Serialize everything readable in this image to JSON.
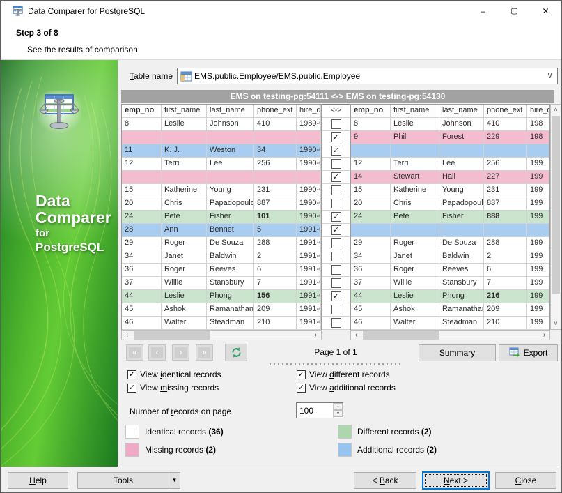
{
  "window": {
    "title": "Data Comparer for PostgreSQL"
  },
  "icons": {
    "minimize": "–",
    "maximize": "▢",
    "close": "✕",
    "chevron_down": "∨",
    "dropdown_arrow": "▼",
    "spin_up": "▲",
    "spin_down": "▼",
    "check": "✓",
    "scroll_left": "‹",
    "scroll_right": "›",
    "scroll_up": "˄",
    "scroll_down": "˅"
  },
  "wizard": {
    "step": "Step 3 of 8",
    "subtitle": "See the results of comparison"
  },
  "sidebar": {
    "brand1": "Data",
    "brand2": "Comparer",
    "brand3": "for",
    "brand4": "PostgreSQL"
  },
  "table_bar": {
    "label": {
      "pre": "",
      "key": "T",
      "post": "able name"
    },
    "value": "EMS.public.Employee/EMS.public.Employee"
  },
  "caption": "EMS on testing-pg:54111 <-> EMS on testing-pg:54130",
  "grid": {
    "columns": [
      "emp_no",
      "first_name",
      "last_name",
      "phone_ext",
      "hire_date"
    ],
    "compare_header": "<->",
    "left_rows": [
      {
        "cells": [
          "8",
          "Leslie",
          "Johnson",
          "410",
          "1989-0"
        ],
        "type": "identical"
      },
      {
        "cells": [
          "",
          "",
          "",
          "",
          ""
        ],
        "type": "missing"
      },
      {
        "cells": [
          "11",
          "K. J.",
          "Weston",
          "34",
          "1990-0"
        ],
        "type": "additional"
      },
      {
        "cells": [
          "12",
          "Terri",
          "Lee",
          "256",
          "1990-0"
        ],
        "type": "identical"
      },
      {
        "cells": [
          "",
          "",
          "",
          "",
          ""
        ],
        "type": "missing"
      },
      {
        "cells": [
          "15",
          "Katherine",
          "Young",
          "231",
          "1990-0"
        ],
        "type": "identical"
      },
      {
        "cells": [
          "20",
          "Chris",
          "Papadopoulos",
          "887",
          "1990-0"
        ],
        "type": "identical"
      },
      {
        "cells": [
          "24",
          "Pete",
          "Fisher",
          "101",
          "1990-0"
        ],
        "type": "different",
        "bold": 3
      },
      {
        "cells": [
          "28",
          "Ann",
          "Bennet",
          "5",
          "1991-0"
        ],
        "type": "additional"
      },
      {
        "cells": [
          "29",
          "Roger",
          "De Souza",
          "288",
          "1991-0"
        ],
        "type": "identical"
      },
      {
        "cells": [
          "34",
          "Janet",
          "Baldwin",
          "2",
          "1991-0"
        ],
        "type": "identical"
      },
      {
        "cells": [
          "36",
          "Roger",
          "Reeves",
          "6",
          "1991-0"
        ],
        "type": "identical"
      },
      {
        "cells": [
          "37",
          "Willie",
          "Stansbury",
          "7",
          "1991-0"
        ],
        "type": "identical"
      },
      {
        "cells": [
          "44",
          "Leslie",
          "Phong",
          "156",
          "1991-0"
        ],
        "type": "different",
        "bold": 3
      },
      {
        "cells": [
          "45",
          "Ashok",
          "Ramanathan",
          "209",
          "1991-0"
        ],
        "type": "identical"
      },
      {
        "cells": [
          "46",
          "Walter",
          "Steadman",
          "210",
          "1991-0"
        ],
        "type": "identical"
      }
    ],
    "selected": [
      false,
      true,
      true,
      false,
      true,
      false,
      false,
      true,
      true,
      false,
      false,
      false,
      false,
      true,
      false,
      false
    ],
    "right_rows": [
      {
        "cells": [
          "8",
          "Leslie",
          "Johnson",
          "410",
          "198"
        ],
        "type": "identical"
      },
      {
        "cells": [
          "9",
          "Phil",
          "Forest",
          "229",
          "198"
        ],
        "type": "missing"
      },
      {
        "cells": [
          "",
          "",
          "",
          "",
          ""
        ],
        "type": "additional"
      },
      {
        "cells": [
          "12",
          "Terri",
          "Lee",
          "256",
          "199"
        ],
        "type": "identical"
      },
      {
        "cells": [
          "14",
          "Stewart",
          "Hall",
          "227",
          "199"
        ],
        "type": "missing"
      },
      {
        "cells": [
          "15",
          "Katherine",
          "Young",
          "231",
          "199"
        ],
        "type": "identical"
      },
      {
        "cells": [
          "20",
          "Chris",
          "Papadopoulos",
          "887",
          "199"
        ],
        "type": "identical"
      },
      {
        "cells": [
          "24",
          "Pete",
          "Fisher",
          "888",
          "199"
        ],
        "type": "different",
        "bold": 3
      },
      {
        "cells": [
          "",
          "",
          "",
          "",
          ""
        ],
        "type": "additional"
      },
      {
        "cells": [
          "29",
          "Roger",
          "De Souza",
          "288",
          "199"
        ],
        "type": "identical"
      },
      {
        "cells": [
          "34",
          "Janet",
          "Baldwin",
          "2",
          "199"
        ],
        "type": "identical"
      },
      {
        "cells": [
          "36",
          "Roger",
          "Reeves",
          "6",
          "199"
        ],
        "type": "identical"
      },
      {
        "cells": [
          "37",
          "Willie",
          "Stansbury",
          "7",
          "199"
        ],
        "type": "identical"
      },
      {
        "cells": [
          "44",
          "Leslie",
          "Phong",
          "216",
          "199"
        ],
        "type": "different",
        "bold": 3
      },
      {
        "cells": [
          "45",
          "Ashok",
          "Ramanathan",
          "209",
          "199"
        ],
        "type": "identical"
      },
      {
        "cells": [
          "46",
          "Walter",
          "Steadman",
          "210",
          "199"
        ],
        "type": "identical"
      }
    ]
  },
  "pager": {
    "first": "«",
    "prev": "‹",
    "next": "›",
    "last": "»",
    "page": "Page 1 of 1"
  },
  "actions": {
    "summary": "Summary",
    "export": "Export"
  },
  "options": {
    "view_identical": {
      "pre": "View ",
      "key": "i",
      "post": "dentical records"
    },
    "view_different": {
      "pre": "View ",
      "key": "d",
      "post": "ifferent records"
    },
    "view_missing": {
      "pre": "View ",
      "key": "m",
      "post": "issing records"
    },
    "view_additional": {
      "pre": "View ",
      "key": "a",
      "post": "dditional records"
    },
    "records_label": {
      "pre": "Number of ",
      "key": "r",
      "post": "ecords on page"
    },
    "records_value": "100"
  },
  "legend": {
    "items": [
      {
        "label": "Identical records ",
        "count": "(36)",
        "color": "#FFFFFF"
      },
      {
        "label": "Different records ",
        "count": "(2)",
        "color": "#ABD6AE"
      },
      {
        "label": "Missing records ",
        "count": "(2)",
        "color": "#F0A9C6"
      },
      {
        "label": "Additional records ",
        "count": "(2)",
        "color": "#97C4EE"
      }
    ]
  },
  "colors": {
    "rows": {
      "identical": "#FFFFFF",
      "missing": "#F3BCCF",
      "different": "#CBE4CD",
      "additional": "#A8CDF0"
    },
    "refresh_green": "#2FA06A",
    "caption_bg": "#A2A2A2"
  },
  "footer": {
    "help": {
      "pre": "",
      "key": "H",
      "post": "elp"
    },
    "tools": "Tools",
    "back": {
      "pre": "< ",
      "key": "B",
      "post": "ack"
    },
    "next": {
      "pre": "",
      "key": "N",
      "post": "ext >"
    },
    "close": {
      "pre": "",
      "key": "C",
      "post": "lose"
    }
  }
}
